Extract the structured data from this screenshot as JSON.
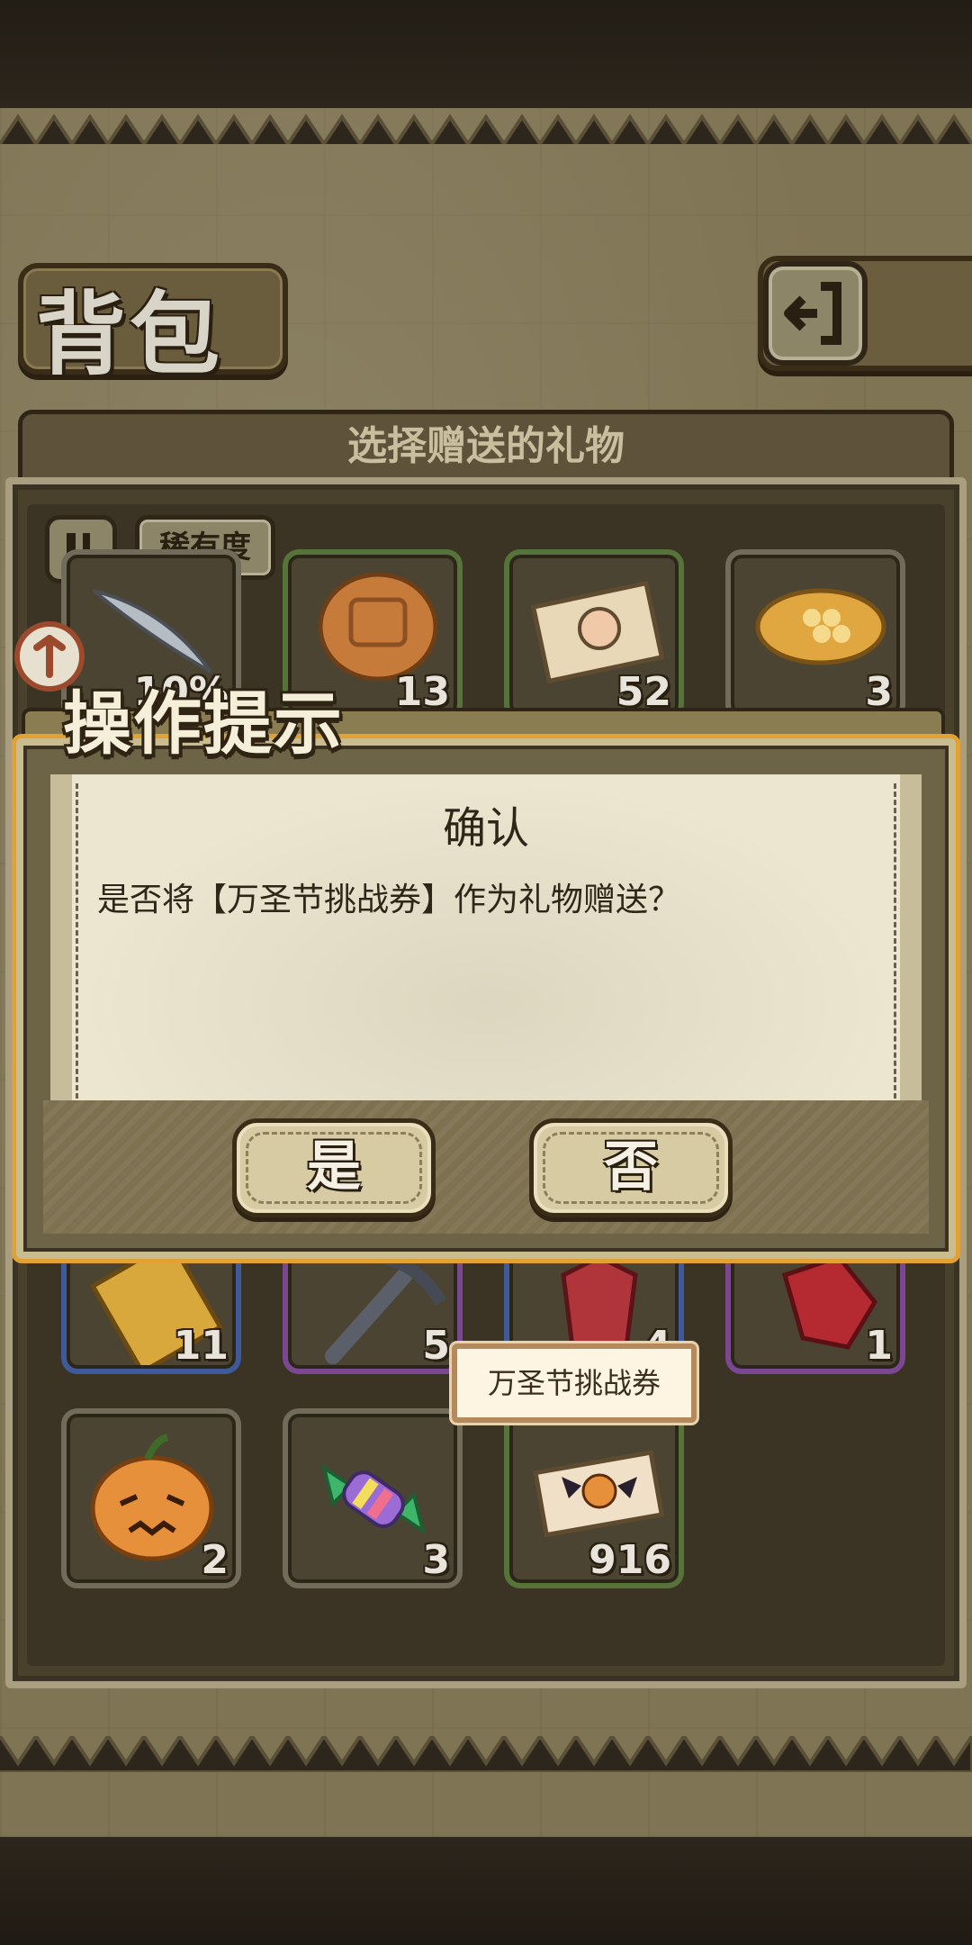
{
  "header": {
    "title": "背包",
    "panel_title": "选择赠送的礼物",
    "sort_label": "稀有度"
  },
  "inventory": {
    "top_row": [
      {
        "name": "feather",
        "count": "10%"
      },
      {
        "name": "mooncake",
        "count": "13"
      },
      {
        "name": "photo-ticket",
        "count": "52"
      },
      {
        "name": "honeycomb",
        "count": "3"
      }
    ],
    "middle_row": [
      {
        "name": "scroll",
        "count": "11"
      },
      {
        "name": "pickaxe",
        "count": "5"
      },
      {
        "name": "red-crystal",
        "count": "4"
      },
      {
        "name": "red-gem",
        "count": "1"
      }
    ],
    "bottom_row": [
      {
        "name": "pumpkin",
        "count": "2"
      },
      {
        "name": "candy",
        "count": "3"
      },
      {
        "name": "halloween-ticket",
        "count": "916"
      }
    ]
  },
  "tooltip": {
    "text": "万圣节挑战券"
  },
  "dialog": {
    "title": "操作提示",
    "heading": "确认",
    "message": "是否将【万圣节挑战券】作为礼物赠送？",
    "yes_label": "是",
    "no_label": "否"
  },
  "colors": {
    "parchment": "#7f7453",
    "dialog_border": "#e2a233",
    "paper": "#ece6d1"
  }
}
